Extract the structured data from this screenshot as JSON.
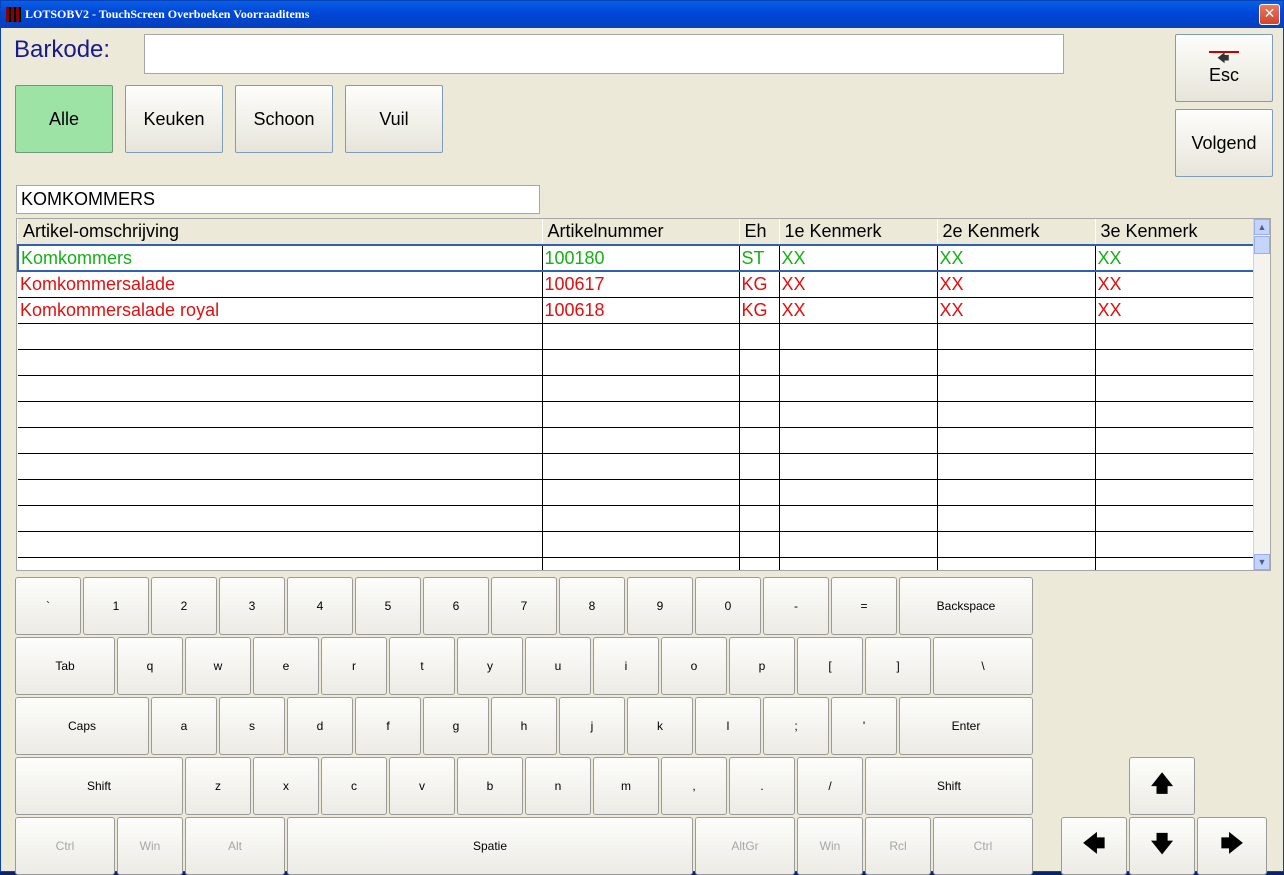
{
  "window": {
    "title": "LOTSOBV2 - TouchScreen Overboeken Voorraaditems",
    "close": "✕"
  },
  "barcode": {
    "label": "Barkode:",
    "value": ""
  },
  "filters": [
    {
      "label": "Alle",
      "active": true
    },
    {
      "label": "Keuken",
      "active": false
    },
    {
      "label": "Schoon",
      "active": false
    },
    {
      "label": "Vuil",
      "active": false
    }
  ],
  "actions": {
    "esc_label": "Esc",
    "esc_icon": "back-arrow-icon",
    "next_label": "Volgend"
  },
  "search": {
    "value": "KOMKOMMERS"
  },
  "grid": {
    "columns": [
      "Artikel-omschrijving",
      "Artikelnummer",
      "Eh",
      "1e Kenmerk",
      "2e Kenmerk",
      "3e Kenmerk"
    ],
    "rows": [
      {
        "cells": [
          "Komkommers",
          "100180",
          "ST",
          "XX",
          "XX",
          "XX"
        ],
        "color": "#16b016",
        "selected": true
      },
      {
        "cells": [
          "Komkommersalade",
          "100617",
          "KG",
          "XX",
          "XX",
          "XX"
        ],
        "color": "#e01010",
        "selected": false
      },
      {
        "cells": [
          "Komkommersalade royal",
          "100618",
          "KG",
          "XX",
          "XX",
          "XX"
        ],
        "color": "#e01010",
        "selected": false
      }
    ],
    "empty_rows": 10
  },
  "keyboard": {
    "row1": [
      "`",
      "1",
      "2",
      "3",
      "4",
      "5",
      "6",
      "7",
      "8",
      "9",
      "0",
      "-",
      "=",
      "Backspace"
    ],
    "row2": [
      "Tab",
      "q",
      "w",
      "e",
      "r",
      "t",
      "y",
      "u",
      "i",
      "o",
      "p",
      "[",
      "]",
      "\\"
    ],
    "row3": [
      "Caps",
      "a",
      "s",
      "d",
      "f",
      "g",
      "h",
      "j",
      "k",
      "l",
      ";",
      "'",
      "Enter"
    ],
    "row4": [
      "Shift",
      "z",
      "x",
      "c",
      "v",
      "b",
      "n",
      "m",
      ",",
      ".",
      "/",
      "Shift"
    ],
    "row5": [
      "Ctrl",
      "Win",
      "Alt",
      "Spatie",
      "AltGr",
      "Win",
      "Rcl",
      "Ctrl"
    ],
    "arrows": {
      "up": "🡅",
      "left": "🡄",
      "down": "🡇",
      "right": "🡆"
    }
  }
}
